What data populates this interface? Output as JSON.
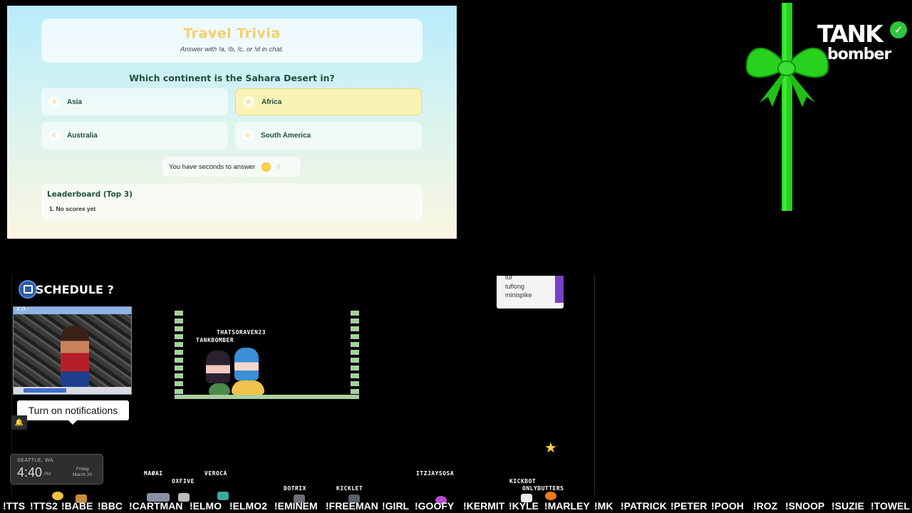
{
  "trivia": {
    "title": "Travel Trivia",
    "subtitle": "Answer with !a, !b, !c, or !d in chat.",
    "question": "Which continent is the Sahara Desert in?",
    "options": [
      {
        "letter": "A",
        "text": "Asia",
        "selected": false
      },
      {
        "letter": "B",
        "text": "Africa",
        "selected": true
      },
      {
        "letter": "C",
        "text": "Australia",
        "selected": false
      },
      {
        "letter": "D",
        "text": "South America",
        "selected": false
      }
    ],
    "timer_text": "You have seconds to answer",
    "timer_value": "0",
    "leaderboard_title": "Leaderboard (Top 3)",
    "leaderboard_rows": [
      "1. No scores yet"
    ]
  },
  "logo": {
    "top": "TANK",
    "bottom": "bomber",
    "check": "✓"
  },
  "schedule": {
    "label": "SCHEDULE ?"
  },
  "video": {
    "bar_label": "X O -"
  },
  "notification": {
    "label": "Turn on notifications",
    "bell": "🔔"
  },
  "game": {
    "names": [
      "THATSORAVEN23",
      "TANKBOMBER"
    ]
  },
  "chat": {
    "lines": [
      "tur",
      "tuflong",
      "minispike"
    ]
  },
  "weather": {
    "city": "SEATTLE, WA",
    "time": "4:40",
    "ampm": "PM",
    "day": "Friday",
    "date": "March 20"
  },
  "players": [
    {
      "name": "MAØAI"
    },
    {
      "name": "OXFIVE"
    },
    {
      "name": "VEROCA"
    },
    {
      "name": "BOTRIX"
    },
    {
      "name": "KICKLET"
    },
    {
      "name": "ITZJAYSOSA"
    },
    {
      "name": "KICKBOT"
    },
    {
      "name": "ONLYBUTTERS"
    }
  ],
  "commands": [
    "!TTS",
    "!TTS2",
    "!BABE",
    "!BBC",
    "!CARTMAN",
    "!ELMO",
    "!ELMO2",
    "!EMINEM",
    "!FREEMAN",
    "!GIRL",
    "!GOOFY",
    "!KERMIT",
    "!KYLE",
    "!MARLEY",
    "!MK",
    "!PATRICK",
    "!PETER",
    "!POOH",
    "!ROZ",
    "!SNOOP",
    "!SUZIE",
    "!TOWEL"
  ],
  "colors": {
    "ribbon": "#22d41c",
    "accent_gold": "#f6cf6a",
    "chat_bar": "#7b3fc3"
  }
}
